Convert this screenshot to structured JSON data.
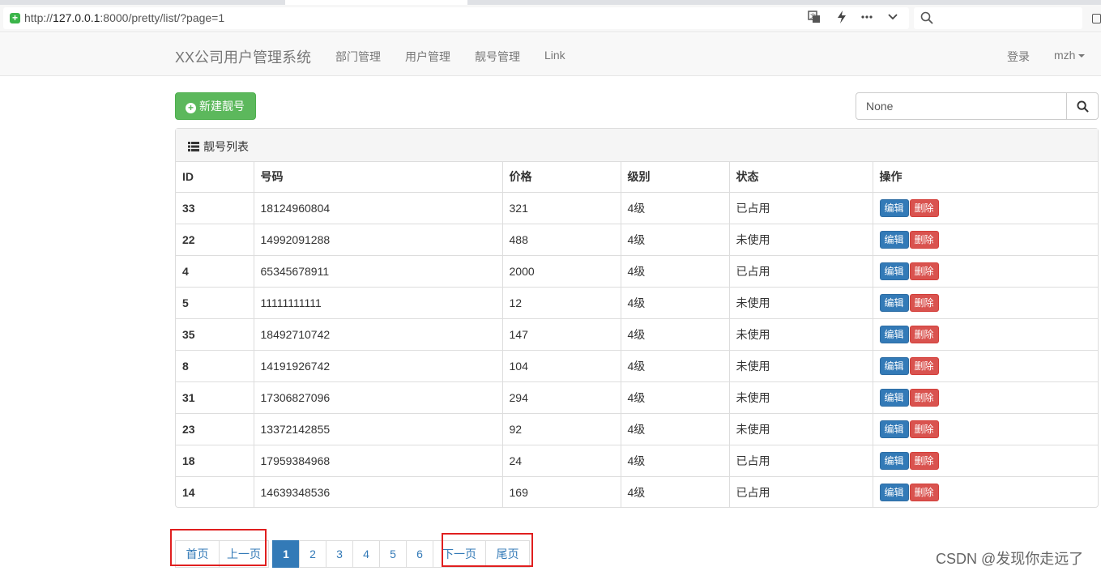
{
  "browser": {
    "url_prefix": "http://",
    "url_host": "127.0.0.1",
    "url_rest": ":8000/pretty/list/?page=1"
  },
  "navbar": {
    "brand": "XX公司用户管理系统",
    "links": [
      "部门管理",
      "用户管理",
      "靓号管理",
      "Link"
    ],
    "login": "登录",
    "user": "mzh"
  },
  "toolbar": {
    "new_button": "新建靓号",
    "search_value": "None"
  },
  "panel": {
    "title": "靓号列表"
  },
  "table": {
    "headers": [
      "ID",
      "号码",
      "价格",
      "级别",
      "状态",
      "操作"
    ],
    "rows": [
      [
        "33",
        "18124960804",
        "321",
        "4级",
        "已占用"
      ],
      [
        "22",
        "14992091288",
        "488",
        "4级",
        "未使用"
      ],
      [
        "4",
        "65345678911",
        "2000",
        "4级",
        "已占用"
      ],
      [
        "5",
        "11111111111",
        "12",
        "4级",
        "未使用"
      ],
      [
        "35",
        "18492710742",
        "147",
        "4级",
        "未使用"
      ],
      [
        "8",
        "14191926742",
        "104",
        "4级",
        "未使用"
      ],
      [
        "31",
        "17306827096",
        "294",
        "4级",
        "未使用"
      ],
      [
        "23",
        "13372142855",
        "92",
        "4级",
        "未使用"
      ],
      [
        "18",
        "17959384968",
        "24",
        "4级",
        "已占用"
      ],
      [
        "14",
        "14639348536",
        "169",
        "4级",
        "已占用"
      ]
    ],
    "edit_label": "编辑",
    "delete_label": "删除"
  },
  "pagination": {
    "first": "首页",
    "prev": "上一页",
    "pages": [
      "1",
      "2",
      "3",
      "4",
      "5",
      "6"
    ],
    "current": "1",
    "next": "下一页",
    "last": "尾页"
  },
  "watermark": "CSDN @发现你走远了",
  "colors": {
    "primary": "#337ab7",
    "success": "#5cb85c",
    "danger": "#d9534f",
    "highlight": "#e01f1f"
  }
}
